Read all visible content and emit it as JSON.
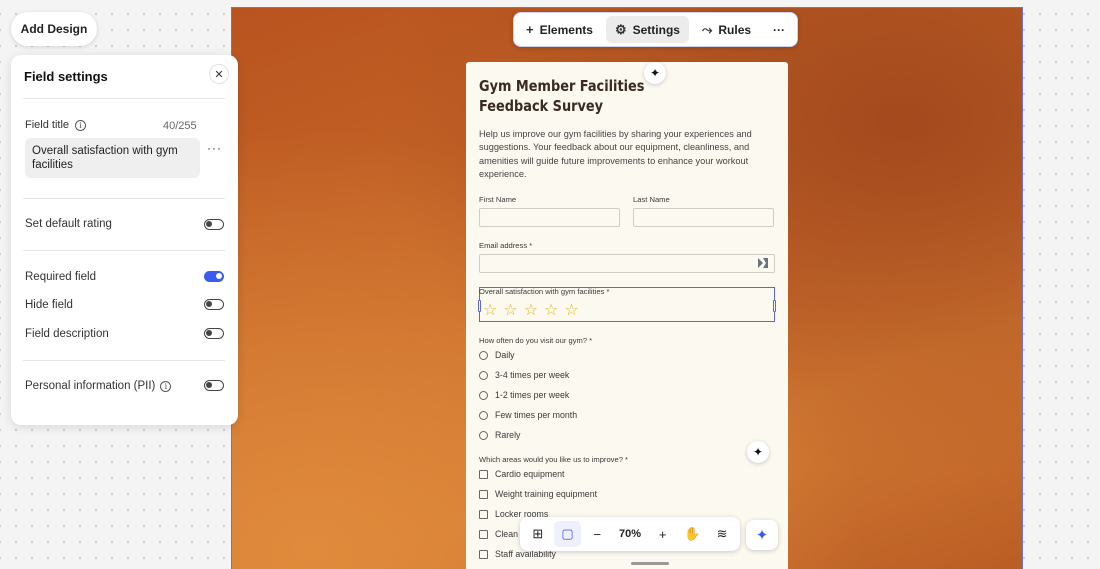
{
  "add_design": {
    "label": "Add Design"
  },
  "panel": {
    "title": "Field settings",
    "close_icon": "✕",
    "field_title": {
      "label": "Field title",
      "counter": "40/255",
      "value": "Overall satisfaction with gym facilities"
    },
    "more_icon": "···",
    "rows": [
      {
        "label": "Set default rating",
        "on": false
      },
      {
        "label": "Required field",
        "on": true
      },
      {
        "label": "Hide field",
        "on": false
      },
      {
        "label": "Field description",
        "on": false
      },
      {
        "label": "Personal information (PII)",
        "on": false
      }
    ]
  },
  "topbar": {
    "elements_label": "Elements",
    "settings_label": "Settings",
    "rules_label": "Rules",
    "more_icon": "···",
    "plus_icon": "+",
    "gear_icon": "⚙",
    "rules_icon": "⤳"
  },
  "form": {
    "title": "Gym Member Facilities Feedback Survey",
    "description": "Help us improve our gym facilities by sharing your experiences and suggestions. Your feedback about our equipment, cleanliness, and amenities will guide future improvements to enhance your workout experience.",
    "first_name": "First Name",
    "last_name": "Last Name",
    "email": "Email address *",
    "rating_label": "Overall satisfaction with gym facilities *",
    "rating_stars": 5,
    "star_glyph": "☆",
    "visit_label": "How often do you visit our gym? *",
    "visit_options": [
      "Daily",
      "3-4 times per week",
      "1-2 times per week",
      "Few times per month",
      "Rarely"
    ],
    "improve_label": "Which areas would you like us to improve? *",
    "improve_options": [
      "Cardio equipment",
      "Weight training equipment",
      "Locker rooms",
      "Clean",
      "Staff availability"
    ],
    "sparkle_icon": "✦"
  },
  "bottombar": {
    "grid_icon": "⊞",
    "frame_icon": "▢",
    "minus_icon": "−",
    "zoom": "70%",
    "plus_icon": "+",
    "hand_icon": "✋",
    "layers_icon": "≋",
    "ai_icon": "✦"
  },
  "colors": {
    "accent": "#3a5cf0",
    "canvas": "#c76a2a",
    "selection": "#5a69d8",
    "star": "#e6b422"
  }
}
